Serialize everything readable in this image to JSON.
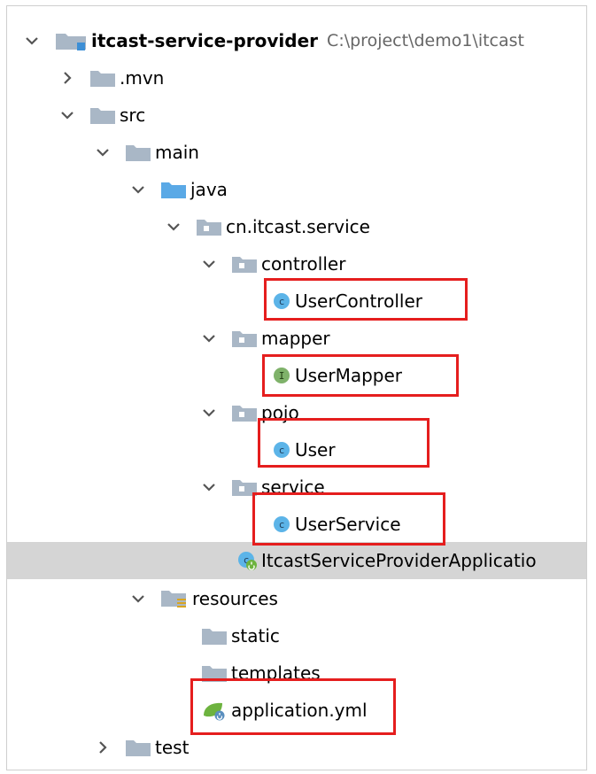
{
  "tree": {
    "items": [
      {
        "label": "itcast-service-provider",
        "path": "C:\\project\\demo1\\itcast",
        "icon": "module-folder-icon",
        "expanded": "true"
      },
      {
        "label": ".mvn",
        "icon": "folder-icon",
        "expanded": "false"
      },
      {
        "label": "src",
        "icon": "folder-icon",
        "expanded": "true"
      },
      {
        "label": "main",
        "icon": "folder-icon",
        "expanded": "true"
      },
      {
        "label": "java",
        "icon": "source-folder-icon",
        "expanded": "true"
      },
      {
        "label": "cn.itcast.service",
        "icon": "package-icon",
        "expanded": "true"
      },
      {
        "label": "controller",
        "icon": "package-icon",
        "expanded": "true"
      },
      {
        "label": "UserController",
        "icon": "class-icon",
        "icon_letter": "c"
      },
      {
        "label": "mapper",
        "icon": "package-icon",
        "expanded": "true"
      },
      {
        "label": "UserMapper",
        "icon": "interface-icon",
        "icon_letter": "I"
      },
      {
        "label": "pojo",
        "icon": "package-icon",
        "expanded": "true"
      },
      {
        "label": "User",
        "icon": "class-icon",
        "icon_letter": "c"
      },
      {
        "label": "service",
        "icon": "package-icon",
        "expanded": "true"
      },
      {
        "label": "UserService",
        "icon": "class-icon",
        "icon_letter": "c"
      },
      {
        "label": "ItcastServiceProviderApplicatio",
        "icon": "spring-boot-class-icon",
        "icon_letter": "c",
        "selected": "true"
      },
      {
        "label": "resources",
        "icon": "resources-folder-icon",
        "expanded": "true"
      },
      {
        "label": "static",
        "icon": "folder-icon"
      },
      {
        "label": "templates",
        "icon": "folder-icon"
      },
      {
        "label": "application.yml",
        "icon": "spring-config-icon"
      },
      {
        "label": "test",
        "icon": "folder-icon",
        "expanded": "false"
      }
    ]
  },
  "colors": {
    "highlight_box": "#e51e1e",
    "selection_bg": "#d5d5d5",
    "folder": "#a9b7c6",
    "source_folder": "#5aa9e6",
    "class_icon": "#5cb4e8",
    "interface_icon": "#7fb26a",
    "spring_green": "#6db33f"
  }
}
